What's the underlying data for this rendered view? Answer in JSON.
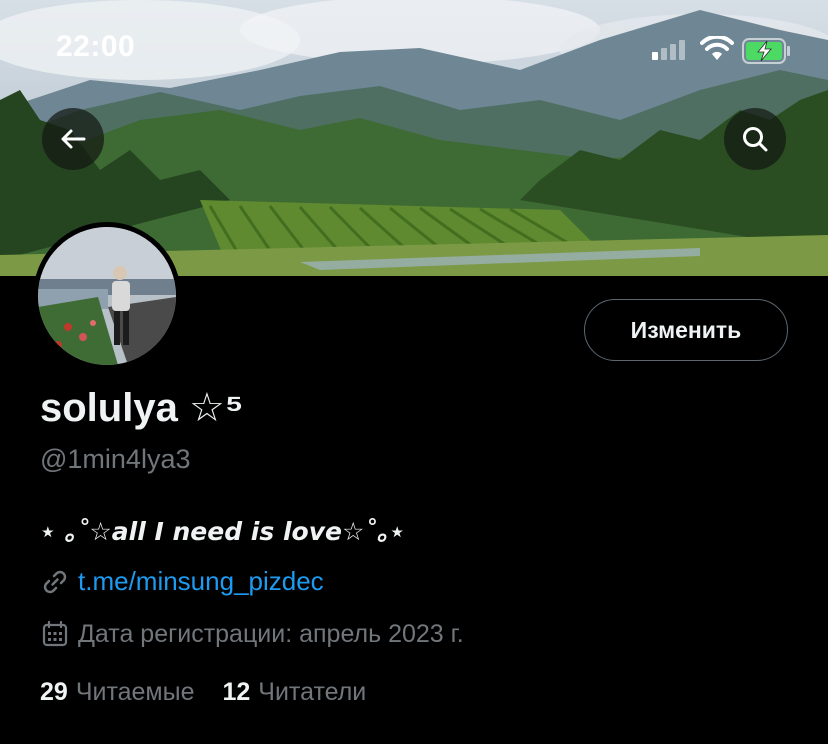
{
  "status_bar": {
    "time": "22:00",
    "icons": [
      "signal-icon",
      "wifi-icon",
      "battery-charging-icon"
    ],
    "battery_color": "#4cd964"
  },
  "header": {
    "back_icon": "arrow-left-icon",
    "search_icon": "search-icon"
  },
  "profile": {
    "edit_label": "Изменить",
    "display_name": "solulya ☆⁵",
    "handle": "@1min4lya3",
    "bio": "⋆ ｡˚☆all I need is love☆˚｡⋆",
    "link_icon": "link-icon",
    "link": "t.me/minsung_pizdec",
    "calendar_icon": "calendar-icon",
    "joined": "Дата регистрации: апрель 2023 г.",
    "following_count": "29",
    "following_label": "Читаемые",
    "followers_count": "12",
    "followers_label": "Читатели"
  },
  "colors": {
    "background": "#000000",
    "primary_text": "#eff3f4",
    "secondary_text": "#71767b",
    "link": "#1d9bf0"
  }
}
